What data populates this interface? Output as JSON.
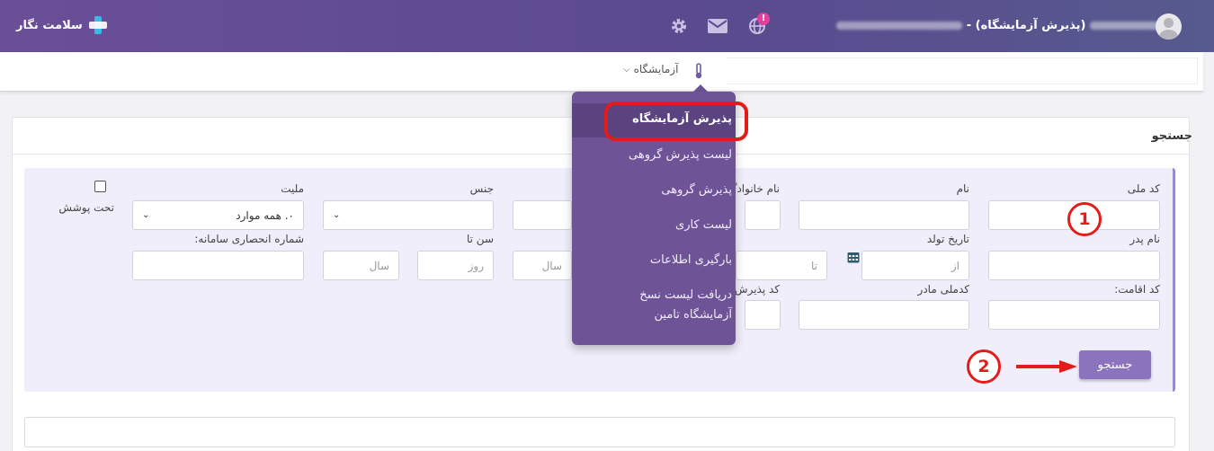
{
  "header": {
    "brand": "سلامت نگار",
    "page_label": "(پذیرش آزمایشگاه) -",
    "notification_badge": "!"
  },
  "nav": {
    "lab_menu": "آزمایشگاه"
  },
  "dropdown": {
    "items": [
      "پذیرش آزمایشگاه",
      "لیست پذیرش گروهی",
      "پذیرش گروهی",
      "لیست کاری",
      "بارگیری اطلاعات",
      "دریافت لیست نسخ",
      "آزمایشگاه تامین"
    ]
  },
  "panel": {
    "title": "جستجو"
  },
  "form": {
    "national_code": "کد ملی",
    "first_name": "نام",
    "family_name": "نام خانوادگ",
    "gender": "جنس",
    "nationality": "ملیت",
    "nationality_value": "۰. همه موارد",
    "insured": "تحت پوشش",
    "father_name": "نام پدر",
    "birth_date": "تاریخ تولد",
    "from_ph": "از",
    "to_ph": "تا",
    "year_ph": "سال",
    "day_ph": "روز",
    "age_to": "سن تا",
    "system_id": "شماره انحصاری سامانه:",
    "residence_code": "کد اقامت:",
    "mother_national_code": "کدملی مادر",
    "reception_code": "کد پذیرش",
    "search_button": "جستجو"
  },
  "annotations": {
    "step1": "1",
    "step2": "2"
  },
  "colors": {
    "header": "#5a4a8f",
    "menu": "#6e5497",
    "button": "#8b73be",
    "annotation": "#e31b1b"
  }
}
